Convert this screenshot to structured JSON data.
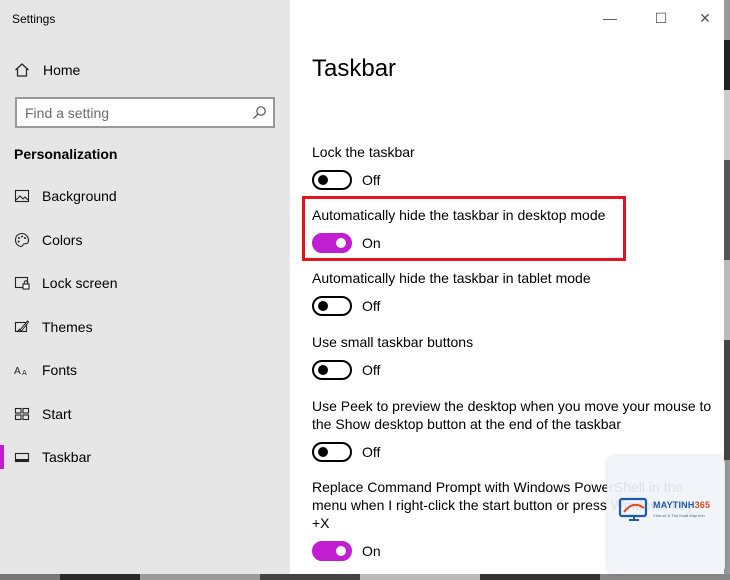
{
  "app": {
    "title": "Settings"
  },
  "window_controls": {
    "minimize": "—",
    "maximize": "☐",
    "close": "✕"
  },
  "sidebar": {
    "home_label": "Home",
    "search": {
      "placeholder": "Find a setting"
    },
    "section_title": "Personalization",
    "items": [
      {
        "label": "Background",
        "icon": "image-icon"
      },
      {
        "label": "Colors",
        "icon": "palette-icon"
      },
      {
        "label": "Lock screen",
        "icon": "lock-screen-icon"
      },
      {
        "label": "Themes",
        "icon": "themes-icon"
      },
      {
        "label": "Fonts",
        "icon": "fonts-icon"
      },
      {
        "label": "Start",
        "icon": "start-icon"
      },
      {
        "label": "Taskbar",
        "icon": "taskbar-icon",
        "active": true
      }
    ]
  },
  "main": {
    "title": "Taskbar",
    "settings": [
      {
        "label": "Lock the taskbar",
        "state": "Off",
        "on": false
      },
      {
        "label": "Automatically hide the taskbar in desktop mode",
        "state": "On",
        "on": true
      },
      {
        "label": "Automatically hide the taskbar in tablet mode",
        "state": "Off",
        "on": false
      },
      {
        "label": "Use small taskbar buttons",
        "state": "Off",
        "on": false
      },
      {
        "label": "Use Peek to preview the desktop when you move your mouse to the Show desktop button at the end of the taskbar",
        "state": "Off",
        "on": false
      },
      {
        "label": "Replace Command Prompt with Windows PowerShell in the menu when I right-click the start button or press Windows key +X",
        "state": "On",
        "on": true
      }
    ]
  },
  "colors": {
    "accent": "#c01ed0",
    "highlight": "#e3141f",
    "sidebar_bg": "#e6e6e6"
  },
  "watermark": {
    "brand_main": "MAYTINH",
    "brand_accent": "365",
    "tagline": "Chia sẻ & Thủ thuật Máy tính"
  }
}
